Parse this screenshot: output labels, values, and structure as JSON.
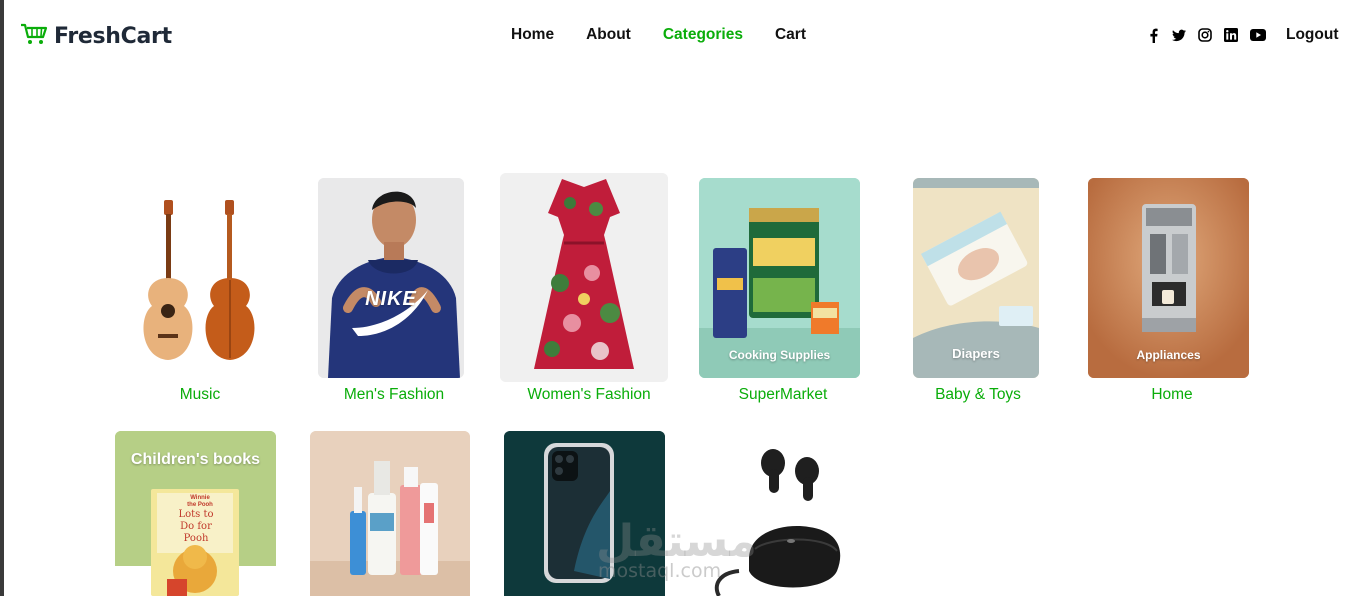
{
  "header": {
    "brand": "FreshCart",
    "nav": [
      "Home",
      "About",
      "Categories",
      "Cart"
    ],
    "active_nav": "Categories",
    "social_icons": [
      "facebook-icon",
      "twitter-icon",
      "instagram-icon",
      "linkedin-icon",
      "youtube-icon"
    ],
    "logout": "Logout"
  },
  "categories": [
    {
      "name": "Music",
      "image_text": ""
    },
    {
      "name": "Men's Fashion",
      "image_text": "NIKE"
    },
    {
      "name": "Women's Fashion",
      "image_text": ""
    },
    {
      "name": "SuperMarket",
      "image_text": "Cooking Supplies"
    },
    {
      "name": "Baby & Toys",
      "image_text": "Diapers"
    },
    {
      "name": "Home",
      "image_text": "Appliances"
    },
    {
      "name": "",
      "image_text": "Children's books",
      "book_title": "Lots to Do for Pooh",
      "book_brand": "Winnie the Pooh"
    },
    {
      "name": "",
      "image_text": ""
    },
    {
      "name": "",
      "image_text": ""
    },
    {
      "name": "",
      "image_text": ""
    }
  ],
  "watermark": {
    "arabic": "مستقل",
    "latin": "mostaql.com"
  },
  "colors": {
    "accent": "#0aad0a",
    "text": "#111111"
  }
}
